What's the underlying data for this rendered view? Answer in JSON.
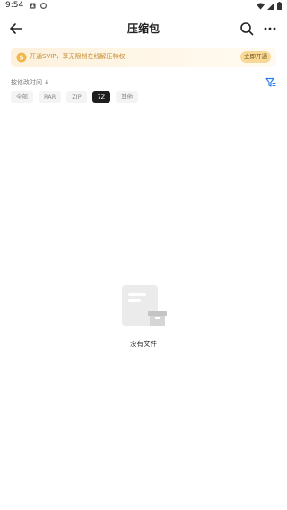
{
  "status_bar": {
    "time": "9:54"
  },
  "header": {
    "title": "压缩包"
  },
  "promo": {
    "text": "开通SVIP，享无限制在线解压特权",
    "button_label": "立即开通"
  },
  "sort": {
    "label": "按修改时间",
    "arrow": "↓"
  },
  "filters": [
    {
      "label": "全部",
      "active": false
    },
    {
      "label": "RAR",
      "active": false
    },
    {
      "label": "ZIP",
      "active": false
    },
    {
      "label": "7Z",
      "active": true
    },
    {
      "label": "其他",
      "active": false
    }
  ],
  "empty_state": {
    "text": "没有文件"
  },
  "colors": {
    "accent": "#2b7de9",
    "promo_text": "#c58a2d",
    "active_chip": "#1e1e1e"
  }
}
